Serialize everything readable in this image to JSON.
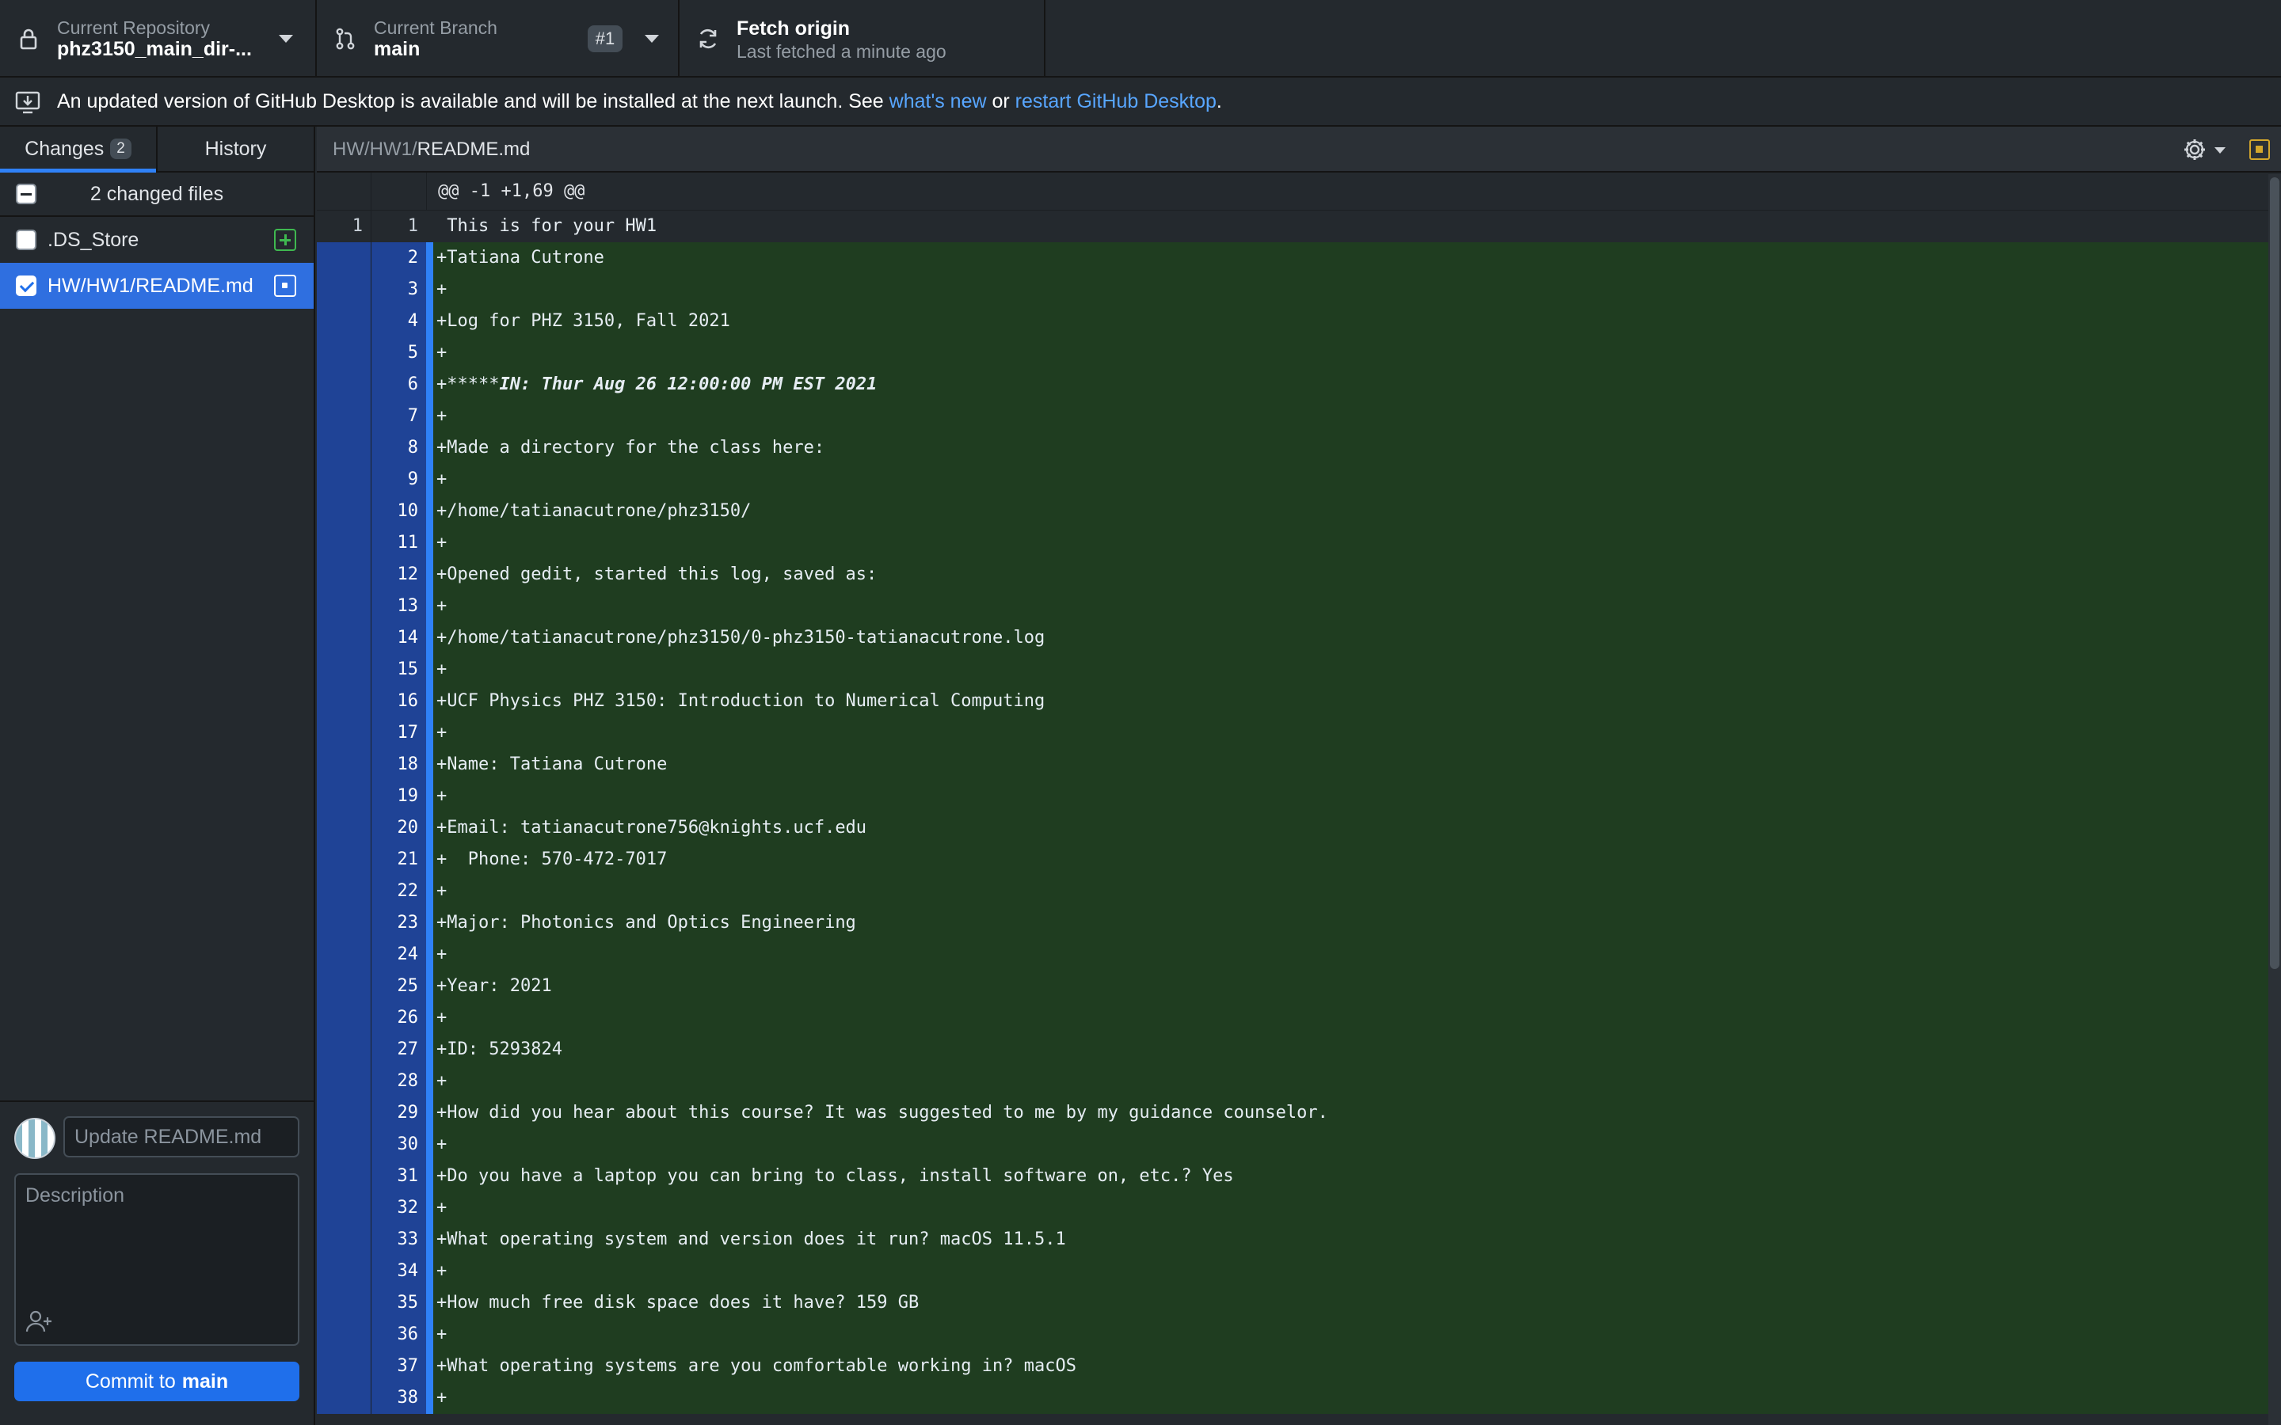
{
  "toolbar": {
    "repo_label": "Current Repository",
    "repo_name": "phz3150_main_dir-...",
    "branch_label": "Current Branch",
    "branch_name": "main",
    "pr_badge": "#1",
    "fetch_title": "Fetch origin",
    "fetch_subtitle": "Last fetched a minute ago"
  },
  "banner": {
    "text_before": "An updated version of GitHub Desktop is available and will be installed at the next launch. See ",
    "link_whats_new": "what's new",
    "text_mid": " or ",
    "link_restart": "restart GitHub Desktop",
    "text_after": "."
  },
  "sidebar": {
    "tab_changes": "Changes",
    "tab_changes_count": "2",
    "tab_history": "History",
    "files_header": "2 changed files",
    "files": [
      {
        "name": ".DS_Store",
        "status": "added",
        "checked": false
      },
      {
        "name": "HW/HW1/README.md",
        "status": "modified",
        "checked": true
      }
    ],
    "summary_placeholder": "Update README.md",
    "description_placeholder": "Description",
    "commit_prefix": "Commit to",
    "commit_branch": "main"
  },
  "diff": {
    "path_dir": "HW/HW1/",
    "path_file": "README.md",
    "hunk": "@@ -1 +1,69 @@",
    "lines": [
      {
        "old": "1",
        "new": "1",
        "type": "context",
        "text": " This is for your HW1"
      },
      {
        "old": "",
        "new": "2",
        "type": "added",
        "text": "+Tatiana Cutrone"
      },
      {
        "old": "",
        "new": "3",
        "type": "added",
        "text": "+"
      },
      {
        "old": "",
        "new": "4",
        "type": "added",
        "text": "+Log for PHZ 3150, Fall 2021"
      },
      {
        "old": "",
        "new": "5",
        "type": "added",
        "text": "+"
      },
      {
        "old": "",
        "new": "6",
        "type": "added",
        "text": "+*****",
        "emph": "IN: Thur Aug 26 12:00:00 PM EST 2021"
      },
      {
        "old": "",
        "new": "7",
        "type": "added",
        "text": "+"
      },
      {
        "old": "",
        "new": "8",
        "type": "added",
        "text": "+Made a directory for the class here:"
      },
      {
        "old": "",
        "new": "9",
        "type": "added",
        "text": "+"
      },
      {
        "old": "",
        "new": "10",
        "type": "added",
        "text": "+/home/tatianacutrone/phz3150/"
      },
      {
        "old": "",
        "new": "11",
        "type": "added",
        "text": "+"
      },
      {
        "old": "",
        "new": "12",
        "type": "added",
        "text": "+Opened gedit, started this log, saved as:"
      },
      {
        "old": "",
        "new": "13",
        "type": "added",
        "text": "+"
      },
      {
        "old": "",
        "new": "14",
        "type": "added",
        "text": "+/home/tatianacutrone/phz3150/0-phz3150-tatianacutrone.log"
      },
      {
        "old": "",
        "new": "15",
        "type": "added",
        "text": "+"
      },
      {
        "old": "",
        "new": "16",
        "type": "added",
        "text": "+UCF Physics PHZ 3150: Introduction to Numerical Computing"
      },
      {
        "old": "",
        "new": "17",
        "type": "added",
        "text": "+"
      },
      {
        "old": "",
        "new": "18",
        "type": "added",
        "text": "+Name: Tatiana Cutrone"
      },
      {
        "old": "",
        "new": "19",
        "type": "added",
        "text": "+"
      },
      {
        "old": "",
        "new": "20",
        "type": "added",
        "text": "+Email: tatianacutrone756@knights.ucf.edu"
      },
      {
        "old": "",
        "new": "21",
        "type": "added",
        "text": "+  Phone: 570-472-7017"
      },
      {
        "old": "",
        "new": "22",
        "type": "added",
        "text": "+"
      },
      {
        "old": "",
        "new": "23",
        "type": "added",
        "text": "+Major: Photonics and Optics Engineering"
      },
      {
        "old": "",
        "new": "24",
        "type": "added",
        "text": "+"
      },
      {
        "old": "",
        "new": "25",
        "type": "added",
        "text": "+Year: 2021"
      },
      {
        "old": "",
        "new": "26",
        "type": "added",
        "text": "+"
      },
      {
        "old": "",
        "new": "27",
        "type": "added",
        "text": "+ID: 5293824"
      },
      {
        "old": "",
        "new": "28",
        "type": "added",
        "text": "+"
      },
      {
        "old": "",
        "new": "29",
        "type": "added",
        "text": "+How did you hear about this course? It was suggested to me by my guidance counselor."
      },
      {
        "old": "",
        "new": "30",
        "type": "added",
        "text": "+"
      },
      {
        "old": "",
        "new": "31",
        "type": "added",
        "text": "+Do you have a laptop you can bring to class, install software on, etc.? Yes"
      },
      {
        "old": "",
        "new": "32",
        "type": "added",
        "text": "+"
      },
      {
        "old": "",
        "new": "33",
        "type": "added",
        "text": "+What operating system and version does it run? macOS 11.5.1"
      },
      {
        "old": "",
        "new": "34",
        "type": "added",
        "text": "+"
      },
      {
        "old": "",
        "new": "35",
        "type": "added",
        "text": "+How much free disk space does it have? 159 GB"
      },
      {
        "old": "",
        "new": "36",
        "type": "added",
        "text": "+"
      },
      {
        "old": "",
        "new": "37",
        "type": "added",
        "text": "+What operating systems are you comfortable working in? macOS"
      },
      {
        "old": "",
        "new": "38",
        "type": "added",
        "text": "+"
      }
    ]
  },
  "colors": {
    "accent": "#2f6fe0",
    "added_bg": "#1f3d20",
    "added_gutter": "#1f4396",
    "link": "#58a6ff"
  }
}
